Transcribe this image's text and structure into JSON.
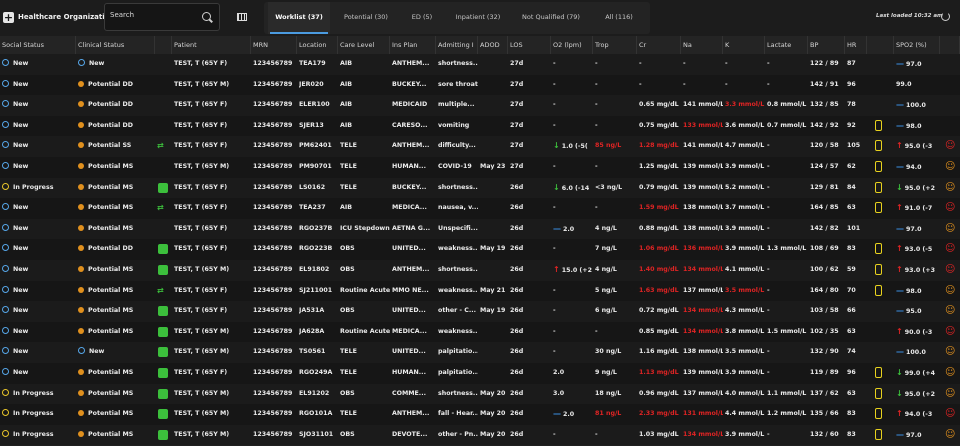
{
  "header": {
    "org_name": "Healthcare Organization",
    "search_placeholder": "Search",
    "tabs": [
      {
        "label": "Worklist (37)"
      },
      {
        "label": "Potential (30)"
      },
      {
        "label": "ED (5)"
      },
      {
        "label": "Inpatient (32)"
      },
      {
        "label": "Not Qualified (79)"
      },
      {
        "label": "All (116)"
      }
    ],
    "last_loaded": "Last loaded 10:32 am"
  },
  "columns": [
    "Social Status",
    "Clinical Status",
    "",
    "Patient",
    "MRN",
    "Location",
    "Care Level",
    "Ins Plan",
    "Admitting I",
    "ADOD",
    "LOS",
    "O2 (lpm)",
    "Trop",
    "Cr",
    "Na",
    "K",
    "Lactate",
    "BP",
    "HR",
    "",
    "SPO2 (%)",
    ""
  ],
  "rows": [
    {
      "social": "New",
      "social_icon": "ring",
      "clinical": "New",
      "clinical_icon": "ring",
      "check": false,
      "eq": false,
      "patient": "TEST, T (65Y F)",
      "mrn": "123456789",
      "location": "TEA179",
      "care": "AIB",
      "ins": "ANTHEM...",
      "admit": "shortness...",
      "adod": "",
      "los": "27d",
      "o2": "-",
      "o2_arrow": "",
      "trop": "-",
      "trop_red": false,
      "cr": "-",
      "cr_red": false,
      "na": "-",
      "na_red": false,
      "k": "-",
      "k_red": false,
      "lactate": "-",
      "bp": "122 / 89",
      "hr": "87",
      "hourglass": false,
      "spo2": "97.0",
      "spo2_arrow": "blue",
      "person": false
    },
    {
      "social": "New",
      "social_icon": "ring",
      "clinical": "Potential DD",
      "clinical_icon": "orange",
      "check": false,
      "eq": false,
      "patient": "TEST, T (65Y M)",
      "mrn": "123456789",
      "location": "JER020",
      "care": "AIB",
      "ins": "BUCKEY...",
      "admit": "sore throat",
      "adod": "",
      "los": "27d",
      "o2": "-",
      "o2_arrow": "",
      "trop": "-",
      "trop_red": false,
      "cr": "-",
      "cr_red": false,
      "na": "-",
      "na_red": false,
      "k": "-",
      "k_red": false,
      "lactate": "-",
      "bp": "142 / 91",
      "hr": "96",
      "hourglass": false,
      "spo2": "99.0",
      "spo2_arrow": "",
      "person": false
    },
    {
      "social": "New",
      "social_icon": "ring",
      "clinical": "Potential DD",
      "clinical_icon": "orange",
      "check": false,
      "eq": false,
      "patient": "TEST, T (65Y F)",
      "mrn": "123456789",
      "location": "ELER100",
      "care": "AIB",
      "ins": "MEDICAID",
      "admit": "multiple...",
      "adod": "",
      "los": "27d",
      "o2": "-",
      "o2_arrow": "",
      "trop": "-",
      "trop_red": false,
      "cr": "0.65 mg/dL",
      "cr_red": false,
      "na": "141 mmol/L",
      "na_red": false,
      "k": "3.3 mmol/L",
      "k_red": true,
      "lactate": "0.8 mmol/L",
      "bp": "132 / 85",
      "hr": "78",
      "hourglass": false,
      "spo2": "100.0",
      "spo2_arrow": "blue",
      "person": false
    },
    {
      "social": "New",
      "social_icon": "ring",
      "clinical": "Potential DD",
      "clinical_icon": "orange",
      "check": false,
      "eq": false,
      "patient": "TEST, T (65Y F)",
      "mrn": "123456789",
      "location": "SJER13",
      "care": "AIB",
      "ins": "CARESO...",
      "admit": "vomiting",
      "adod": "",
      "los": "27d",
      "o2": "-",
      "o2_arrow": "",
      "trop": "-",
      "trop_red": false,
      "cr": "0.75 mg/dL",
      "cr_red": false,
      "na": "133 mmol/L",
      "na_red": true,
      "k": "3.6 mmol/L",
      "k_red": false,
      "lactate": "0.7 mmol/L",
      "bp": "142 / 92",
      "hr": "92",
      "hourglass": true,
      "spo2": "98.0",
      "spo2_arrow": "blue",
      "person": false
    },
    {
      "social": "New",
      "social_icon": "ring",
      "clinical": "Potential SS",
      "clinical_icon": "orange",
      "check": false,
      "eq": true,
      "patient": "TEST, T (65Y F)",
      "mrn": "123456789",
      "location": "PM62401",
      "care": "TELE",
      "ins": "ANTHEM...",
      "admit": "difficulty...",
      "adod": "",
      "los": "27d",
      "o2": "1.0 (-5(",
      "o2_arrow": "green",
      "trop": "85 ng/L",
      "trop_red": true,
      "cr": "1.28 mg/dL",
      "cr_red": true,
      "na": "141 mmol/L",
      "na_red": false,
      "k": "4.7 mmol/L",
      "k_red": false,
      "lactate": "-",
      "bp": "120 / 58",
      "hr": "105",
      "hourglass": true,
      "spo2": "95.0 (-3",
      "spo2_arrow": "red",
      "person": true
    },
    {
      "social": "New",
      "social_icon": "ring",
      "clinical": "Potential MS",
      "clinical_icon": "orange",
      "check": false,
      "eq": false,
      "patient": "TEST, T (65Y M)",
      "mrn": "123456789",
      "location": "PM90701",
      "care": "TELE",
      "ins": "HUMAN...",
      "admit": "COVID-19",
      "adod": "May 23",
      "los": "27d",
      "o2": "-",
      "o2_arrow": "",
      "trop": "-",
      "trop_red": false,
      "cr": "1.25 mg/dL",
      "cr_red": false,
      "na": "139 mmol/L",
      "na_red": false,
      "k": "3.9 mmol/L",
      "k_red": false,
      "lactate": "-",
      "bp": "124 / 57",
      "hr": "62",
      "hourglass": true,
      "spo2": "94.0",
      "spo2_arrow": "blue",
      "person": true
    },
    {
      "social": "In Progress",
      "social_icon": "mag",
      "clinical": "Potential MS",
      "clinical_icon": "orange",
      "check": true,
      "eq": false,
      "patient": "TEST, T (65Y F)",
      "mrn": "123456789",
      "location": "LS0162",
      "care": "TELE",
      "ins": "BUCKEY...",
      "admit": "shortness...",
      "adod": "",
      "los": "26d",
      "o2": "6.0 (-14",
      "o2_arrow": "green",
      "trop": "<3 ng/L",
      "trop_red": false,
      "cr": "0.79 mg/dL",
      "cr_red": false,
      "na": "139 mmol/L",
      "na_red": false,
      "k": "5.2 mmol/L",
      "k_red": false,
      "lactate": "-",
      "bp": "129 / 81",
      "hr": "84",
      "hourglass": true,
      "spo2": "95.0 (+2",
      "spo2_arrow": "green",
      "person": true
    },
    {
      "social": "New",
      "social_icon": "ring",
      "clinical": "Potential MS",
      "clinical_icon": "orange",
      "check": false,
      "eq": true,
      "patient": "TEST, T (65Y F)",
      "mrn": "123456789",
      "location": "TEA237",
      "care": "AIB",
      "ins": "MEDICA...",
      "admit": "nausea, v...",
      "adod": "",
      "los": "26d",
      "o2": "-",
      "o2_arrow": "",
      "trop": "-",
      "trop_red": false,
      "cr": "1.59 mg/dL",
      "cr_red": true,
      "na": "138 mmol/L",
      "na_red": false,
      "k": "3.7 mmol/L",
      "k_red": false,
      "lactate": "-",
      "bp": "164 / 85",
      "hr": "63",
      "hourglass": true,
      "spo2": "91.0 (-7",
      "spo2_arrow": "red",
      "person": true
    },
    {
      "social": "New",
      "social_icon": "ring",
      "clinical": "Potential MS",
      "clinical_icon": "orange",
      "check": false,
      "eq": false,
      "patient": "TEST, T (65Y F)",
      "mrn": "123456789",
      "location": "RGO237B",
      "care": "ICU Stepdown",
      "ins": "AETNA G...",
      "admit": "Unspecifi...",
      "adod": "",
      "los": "26d",
      "o2": "2.0",
      "o2_arrow": "blue",
      "trop": "4 ng/L",
      "trop_red": false,
      "cr": "0.88 mg/dL",
      "cr_red": false,
      "na": "138 mmol/L",
      "na_red": false,
      "k": "3.9 mmol/L",
      "k_red": false,
      "lactate": "-",
      "bp": "142 / 82",
      "hr": "101",
      "hourglass": false,
      "spo2": "97.0",
      "spo2_arrow": "blue",
      "person": true
    },
    {
      "social": "New",
      "social_icon": "ring",
      "clinical": "Potential DD",
      "clinical_icon": "orange",
      "check": true,
      "eq": false,
      "patient": "TEST, T (65Y F)",
      "mrn": "123456789",
      "location": "RGO223B",
      "care": "OBS",
      "ins": "UNITED...",
      "admit": "weakness...",
      "adod": "May 19",
      "los": "26d",
      "o2": "-",
      "o2_arrow": "",
      "trop": "7 ng/L",
      "trop_red": false,
      "cr": "1.06 mg/dL",
      "cr_red": true,
      "na": "136 mmol/L",
      "na_red": true,
      "k": "3.9 mmol/L",
      "k_red": false,
      "lactate": "1.3 mmol/L",
      "bp": "108 / 69",
      "hr": "83",
      "hourglass": true,
      "spo2": "93.0 (-5",
      "spo2_arrow": "red",
      "person": true
    },
    {
      "social": "New",
      "social_icon": "ring",
      "clinical": "Potential MS",
      "clinical_icon": "orange",
      "check": true,
      "eq": false,
      "patient": "TEST, T (65Y M)",
      "mrn": "123456789",
      "location": "EL91802",
      "care": "OBS",
      "ins": "ANTHEM...",
      "admit": "shortness...",
      "adod": "",
      "los": "26d",
      "o2": "15.0 (+2",
      "o2_arrow": "red",
      "trop": "4 ng/L",
      "trop_red": false,
      "cr": "1.40 mg/dL",
      "cr_red": true,
      "na": "134 mmol/L",
      "na_red": true,
      "k": "4.1 mmol/L",
      "k_red": false,
      "lactate": "-",
      "bp": "100 / 62",
      "hr": "59",
      "hourglass": true,
      "spo2": "93.0 (+3",
      "spo2_arrow": "red",
      "person": true
    },
    {
      "social": "New",
      "social_icon": "ring",
      "clinical": "Potential MS",
      "clinical_icon": "orange",
      "check": false,
      "eq": true,
      "patient": "TEST, T (65Y F)",
      "mrn": "123456789",
      "location": "SJ211001",
      "care": "Routine Acute",
      "ins": "MMO NE...",
      "admit": "weakness...",
      "adod": "May 21",
      "los": "26d",
      "o2": "-",
      "o2_arrow": "",
      "trop": "5 ng/L",
      "trop_red": false,
      "cr": "1.63 mg/dL",
      "cr_red": true,
      "na": "137 mmol/L",
      "na_red": false,
      "k": "3.5 mmol/L",
      "k_red": true,
      "lactate": "-",
      "bp": "164 / 80",
      "hr": "70",
      "hourglass": true,
      "spo2": "98.0",
      "spo2_arrow": "blue",
      "person": true
    },
    {
      "social": "New",
      "social_icon": "ring",
      "clinical": "Potential MS",
      "clinical_icon": "orange",
      "check": true,
      "eq": false,
      "patient": "TEST, T (65Y F)",
      "mrn": "123456789",
      "location": "JA531A",
      "care": "OBS",
      "ins": "UNITED...",
      "admit": "other - C...",
      "adod": "May 19",
      "los": "26d",
      "o2": "-",
      "o2_arrow": "",
      "trop": "6 ng/L",
      "trop_red": false,
      "cr": "0.72 mg/dL",
      "cr_red": false,
      "na": "134 mmol/L",
      "na_red": true,
      "k": "4.3 mmol/L",
      "k_red": false,
      "lactate": "-",
      "bp": "103 / 58",
      "hr": "66",
      "hourglass": false,
      "spo2": "95.0",
      "spo2_arrow": "blue",
      "person": true
    },
    {
      "social": "New",
      "social_icon": "ring",
      "clinical": "Potential MS",
      "clinical_icon": "orange",
      "check": true,
      "eq": false,
      "patient": "TEST, T (65Y M)",
      "mrn": "123456789",
      "location": "JA628A",
      "care": "Routine Acute",
      "ins": "MEDICA...",
      "admit": "weakness...",
      "adod": "",
      "los": "26d",
      "o2": "-",
      "o2_arrow": "",
      "trop": "-",
      "trop_red": false,
      "cr": "0.85 mg/dL",
      "cr_red": false,
      "na": "134 mmol/L",
      "na_red": true,
      "k": "3.8 mmol/L",
      "k_red": false,
      "lactate": "1.5 mmol/L",
      "bp": "102 / 35",
      "hr": "63",
      "hourglass": false,
      "spo2": "90.0 (-3",
      "spo2_arrow": "red",
      "person": true
    },
    {
      "social": "New",
      "social_icon": "ring",
      "clinical": "New",
      "clinical_icon": "ring",
      "check": true,
      "eq": false,
      "patient": "TEST, T (65Y M)",
      "mrn": "123456789",
      "location": "TS0561",
      "care": "TELE",
      "ins": "UNITED...",
      "admit": "palpitatio...",
      "adod": "",
      "los": "26d",
      "o2": "-",
      "o2_arrow": "",
      "trop": "30 ng/L",
      "trop_red": false,
      "cr": "1.16 mg/dL",
      "cr_red": false,
      "na": "138 mmol/L",
      "na_red": false,
      "k": "3.5 mmol/L",
      "k_red": false,
      "lactate": "-",
      "bp": "132 / 90",
      "hr": "74",
      "hourglass": false,
      "spo2": "100.0",
      "spo2_arrow": "blue",
      "person": true
    },
    {
      "social": "New",
      "social_icon": "ring",
      "clinical": "Potential MS",
      "clinical_icon": "orange",
      "check": true,
      "eq": false,
      "patient": "TEST, T (65Y F)",
      "mrn": "123456789",
      "location": "RGO249A",
      "care": "TELE",
      "ins": "HUMAN...",
      "admit": "palpitatio...",
      "adod": "",
      "los": "26d",
      "o2": "2.0",
      "o2_arrow": "",
      "trop": "9 ng/L",
      "trop_red": false,
      "cr": "1.13 mg/dL",
      "cr_red": true,
      "na": "139 mmol/L",
      "na_red": false,
      "k": "3.9 mmol/L",
      "k_red": false,
      "lactate": "-",
      "bp": "119 / 89",
      "hr": "96",
      "hourglass": true,
      "spo2": "99.0 (+4",
      "spo2_arrow": "green",
      "person": true
    },
    {
      "social": "In Progress",
      "social_icon": "mag",
      "clinical": "Potential MS",
      "clinical_icon": "orange",
      "check": true,
      "eq": false,
      "patient": "TEST, T (65Y M)",
      "mrn": "123456789",
      "location": "EL91202",
      "care": "OBS",
      "ins": "COMME...",
      "admit": "shortness...",
      "adod": "May 20",
      "los": "26d",
      "o2": "3.0",
      "o2_arrow": "",
      "trop": "18 ng/L",
      "trop_red": false,
      "cr": "0.96 mg/dL",
      "cr_red": false,
      "na": "137 mmol/L",
      "na_red": false,
      "k": "4.0 mmol/L",
      "k_red": false,
      "lactate": "1.1 mmol/L",
      "bp": "137 / 62",
      "hr": "63",
      "hourglass": true,
      "spo2": "95.0 (+2",
      "spo2_arrow": "green",
      "person": true
    },
    {
      "social": "In Progress",
      "social_icon": "mag",
      "clinical": "Potential MS",
      "clinical_icon": "orange",
      "check": true,
      "eq": false,
      "patient": "TEST, T (65Y M)",
      "mrn": "123456789",
      "location": "RGO101A",
      "care": "TELE",
      "ins": "ANTHEM...",
      "admit": "fall - Hear...",
      "adod": "May 20",
      "los": "26d",
      "o2": "2.0",
      "o2_arrow": "blue",
      "trop": "81 ng/L",
      "trop_red": true,
      "cr": "2.33 mg/dL",
      "cr_red": true,
      "na": "131 mmol/L",
      "na_red": true,
      "k": "4.4 mmol/L",
      "k_red": false,
      "lactate": "1.2 mmol/L",
      "bp": "135 / 66",
      "hr": "83",
      "hourglass": true,
      "spo2": "94.0 (-3",
      "spo2_arrow": "red",
      "person": true
    },
    {
      "social": "In Progress",
      "social_icon": "mag",
      "clinical": "Potential MS",
      "clinical_icon": "orange",
      "check": true,
      "eq": false,
      "patient": "TEST, T (65Y M)",
      "mrn": "123456789",
      "location": "SJO31101",
      "care": "OBS",
      "ins": "DEVOTE...",
      "admit": "other - Pn...",
      "adod": "May 20",
      "los": "26d",
      "o2": "-",
      "o2_arrow": "",
      "trop": "-",
      "trop_red": false,
      "cr": "1.03 mg/dL",
      "cr_red": false,
      "na": "134 mmol/L",
      "na_red": true,
      "k": "3.9 mmol/L",
      "k_red": false,
      "lactate": "-",
      "bp": "132 / 60",
      "hr": "83",
      "hourglass": true,
      "spo2": "97.0",
      "spo2_arrow": "blue",
      "person": true
    }
  ]
}
